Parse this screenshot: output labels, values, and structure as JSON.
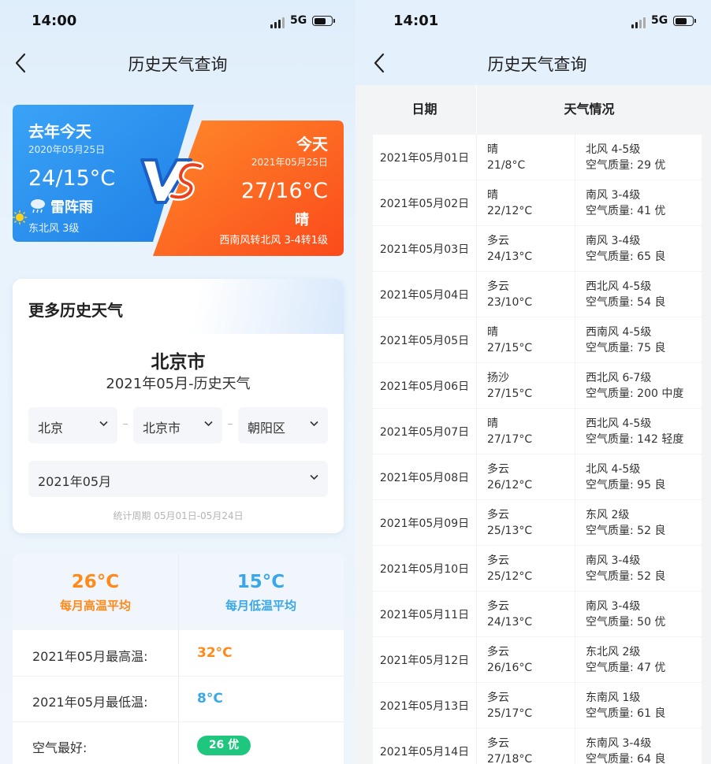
{
  "left_screen": {
    "status": {
      "time": "14:00",
      "network": "5G"
    },
    "nav_title": "历史天气查询",
    "compare": {
      "last_year": {
        "label": "去年今天",
        "date": "2020年05月25日",
        "temp": "24/15°C",
        "weather": "雷阵雨",
        "wind": "东北风 3级"
      },
      "vs": "VS",
      "today": {
        "label": "今天",
        "date": "2021年05月25日",
        "temp": "27/16°C",
        "weather": "晴",
        "wind": "西南风转北风 3-4转1级"
      }
    },
    "more": {
      "title": "更多历史天气",
      "city": "北京市",
      "month_title": "2021年05月-历史天气",
      "selects": [
        "北京",
        "北京市",
        "朝阳区"
      ],
      "month_select": "2021年05月",
      "period": "统计周期  05月01日-05月24日"
    },
    "averages": {
      "high": {
        "value": "26°C",
        "label": "每月高温平均"
      },
      "low": {
        "value": "15°C",
        "label": "每月低温平均"
      },
      "rows": [
        {
          "label": "2021年05月最高温:",
          "value": "32°C"
        },
        {
          "label": "2021年05月最低温:",
          "value": "8°C"
        },
        {
          "label": "空气最好:",
          "value": "26 优"
        }
      ]
    },
    "colors": {
      "blue": "#2f96f3",
      "orange": "#fb6a1c",
      "high": "#ff8a1a",
      "low": "#3aa7e8",
      "good": "#1ec77d"
    }
  },
  "right_screen": {
    "status": {
      "time": "14:01",
      "network": "5G"
    },
    "nav_title": "历史天气查询",
    "headers": {
      "date": "日期",
      "weather": "天气情况"
    },
    "rows": [
      {
        "date": "2021年05月01日",
        "weather": "晴",
        "temp": "21/8°C",
        "wind": "北风 4-5级",
        "aqi": "空气质量: 29 优"
      },
      {
        "date": "2021年05月02日",
        "weather": "晴",
        "temp": "22/12°C",
        "wind": "南风 3-4级",
        "aqi": "空气质量: 41 优"
      },
      {
        "date": "2021年05月03日",
        "weather": "多云",
        "temp": "24/13°C",
        "wind": "南风 3-4级",
        "aqi": "空气质量: 65 良"
      },
      {
        "date": "2021年05月04日",
        "weather": "多云",
        "temp": "23/10°C",
        "wind": "西北风 4-5级",
        "aqi": "空气质量: 54 良"
      },
      {
        "date": "2021年05月05日",
        "weather": "晴",
        "temp": "27/15°C",
        "wind": "西南风 4-5级",
        "aqi": "空气质量: 75 良"
      },
      {
        "date": "2021年05月06日",
        "weather": "扬沙",
        "temp": "27/15°C",
        "wind": "西北风 6-7级",
        "aqi": "空气质量: 200 中度"
      },
      {
        "date": "2021年05月07日",
        "weather": "晴",
        "temp": "27/17°C",
        "wind": "西北风 4-5级",
        "aqi": "空气质量: 142 轻度"
      },
      {
        "date": "2021年05月08日",
        "weather": "多云",
        "temp": "26/12°C",
        "wind": "北风 4-5级",
        "aqi": "空气质量: 95 良"
      },
      {
        "date": "2021年05月09日",
        "weather": "多云",
        "temp": "25/13°C",
        "wind": "东风 2级",
        "aqi": "空气质量: 52 良"
      },
      {
        "date": "2021年05月10日",
        "weather": "多云",
        "temp": "25/12°C",
        "wind": "南风 3-4级",
        "aqi": "空气质量: 52 良"
      },
      {
        "date": "2021年05月11日",
        "weather": "多云",
        "temp": "24/13°C",
        "wind": "南风 3-4级",
        "aqi": "空气质量: 50 优"
      },
      {
        "date": "2021年05月12日",
        "weather": "多云",
        "temp": "26/16°C",
        "wind": "东北风 2级",
        "aqi": "空气质量: 47 优"
      },
      {
        "date": "2021年05月13日",
        "weather": "多云",
        "temp": "25/17°C",
        "wind": "东南风 1级",
        "aqi": "空气质量: 61 良"
      },
      {
        "date": "2021年05月14日",
        "weather": "多云",
        "temp": "27/18°C",
        "wind": "东南风 3-4级",
        "aqi": "空气质量: 64 良"
      }
    ]
  }
}
